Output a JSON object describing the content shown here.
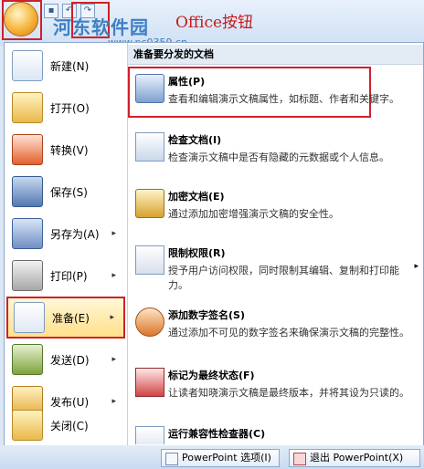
{
  "header": {
    "watermark": "河东软件园",
    "watermark_url": "www.pc0359.cn",
    "title": "Office按钮"
  },
  "left_menu": {
    "items": [
      {
        "label": "新建(N)",
        "icon": "new-document-icon",
        "arrow": ""
      },
      {
        "label": "打开(O)",
        "icon": "open-folder-icon",
        "arrow": ""
      },
      {
        "label": "转换(V)",
        "icon": "convert-icon",
        "arrow": ""
      },
      {
        "label": "保存(S)",
        "icon": "save-disk-icon",
        "arrow": ""
      },
      {
        "label": "另存为(A)",
        "icon": "save-as-icon",
        "arrow": "▸"
      },
      {
        "label": "打印(P)",
        "icon": "printer-icon",
        "arrow": "▸"
      },
      {
        "label": "准备(E)",
        "icon": "prepare-icon",
        "arrow": "▸"
      },
      {
        "label": "发送(D)",
        "icon": "send-icon",
        "arrow": "▸"
      },
      {
        "label": "发布(U)",
        "icon": "publish-icon",
        "arrow": "▸"
      },
      {
        "label": "关闭(C)",
        "icon": "close-folder-icon",
        "arrow": ""
      }
    ]
  },
  "right_panel": {
    "header": "准备要分发的文档",
    "items": [
      {
        "title": "属性(P)",
        "desc": "查看和编辑演示文稿属性，如标题、作者和关键字。"
      },
      {
        "title": "检查文档(I)",
        "desc": "检查演示文稿中是否有隐藏的元数据或个人信息。"
      },
      {
        "title": "加密文档(E)",
        "desc": "通过添加加密增强演示文稿的安全性。"
      },
      {
        "title": "限制权限(R)",
        "desc": "授予用户访问权限，同时限制其编辑、复制和打印能力。"
      },
      {
        "title": "添加数字签名(S)",
        "desc": "通过添加不可见的数字签名来确保演示文稿的完整性。"
      },
      {
        "title": "标记为最终状态(F)",
        "desc": "让读者知晓演示文稿是最终版本，并将其设为只读的。"
      },
      {
        "title": "运行兼容性检查器(C)",
        "desc": ""
      }
    ]
  },
  "bottom": {
    "options_label": "PowerPoint 选项(I)",
    "exit_label": "退出 PowerPoint(X)"
  }
}
